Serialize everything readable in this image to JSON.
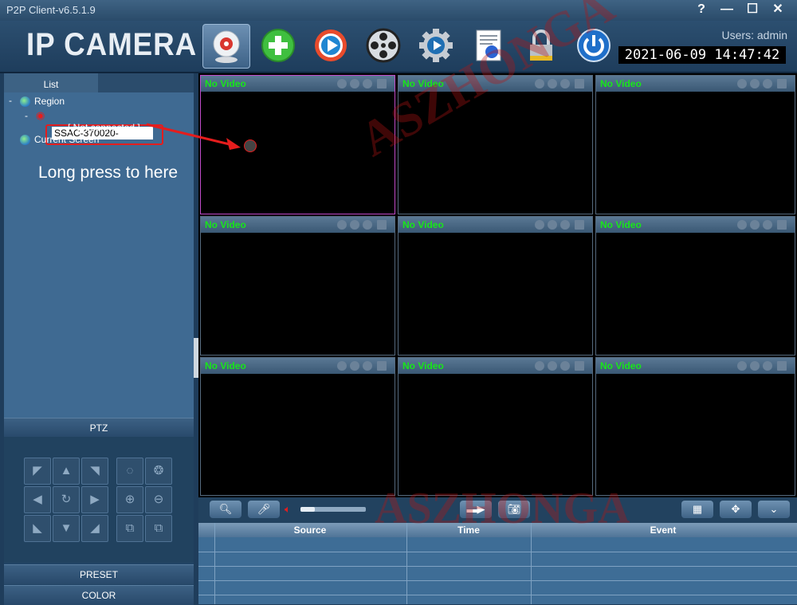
{
  "window": {
    "title": "P2P Client-v6.5.1.9",
    "help": "?",
    "min": "—",
    "max": "☐",
    "close": "✕"
  },
  "header": {
    "logo": "IP CAMERA",
    "users": "Users: admin",
    "clock": "2021-06-09  14:47:42"
  },
  "toolbar": [
    "camera-view-icon",
    "add-device-icon",
    "playback-icon",
    "film-reel-icon",
    "settings-gear-icon",
    "log-document-icon",
    "lock-icon",
    "power-icon"
  ],
  "sidebar": {
    "tab": "List",
    "tree": {
      "region": "Region",
      "device": "SSAC-370020-",
      "status": "[    Not connected    ]",
      "current_screen": "Current Screen"
    },
    "hint": "Long press to here",
    "ptz": "PTZ",
    "preset": "PRESET",
    "color": "COLOR"
  },
  "video": {
    "label": "No Video",
    "cells": 9
  },
  "table": {
    "headers": [
      "Source",
      "Time",
      "Event"
    ]
  },
  "watermark": "ASZHONGA",
  "colors": {
    "accent_green": "#18e61a",
    "annotation_red": "#e51d1d",
    "selected_border": "#c04ac8"
  }
}
